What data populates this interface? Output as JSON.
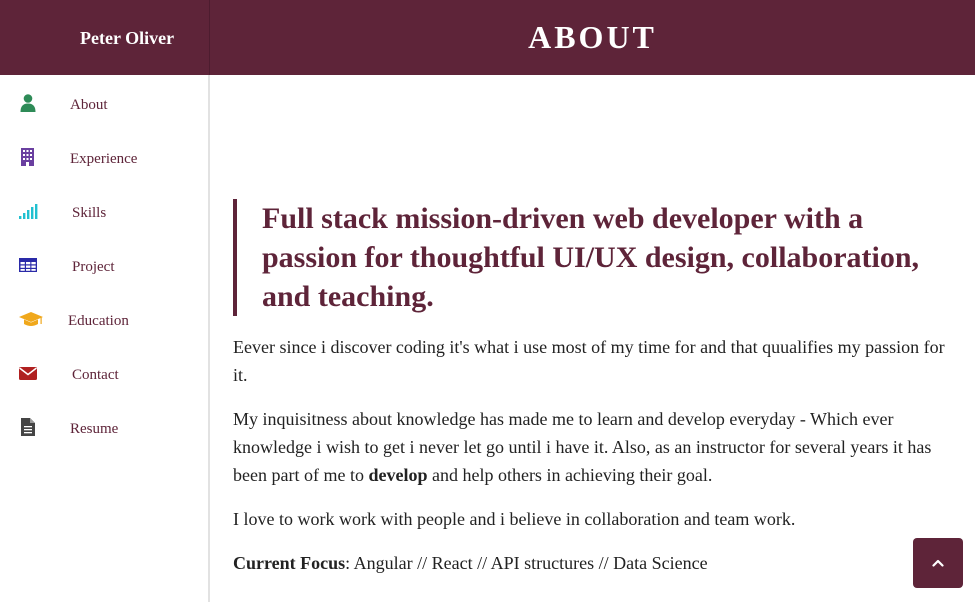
{
  "header": {
    "brand": "Peter Oliver",
    "title": "ABOUT"
  },
  "sidebar": {
    "items": [
      {
        "label": "About",
        "icon": "user-icon",
        "color": "#2e8b57"
      },
      {
        "label": "Experience",
        "icon": "building-icon",
        "color": "#6a3fa0"
      },
      {
        "label": "Skills",
        "icon": "signal-icon",
        "color": "#20c0d0"
      },
      {
        "label": "Project",
        "icon": "table-icon",
        "color": "#2a2aa8"
      },
      {
        "label": "Education",
        "icon": "graduation-cap-icon",
        "color": "#f0a81c"
      },
      {
        "label": "Contact",
        "icon": "envelope-icon",
        "color": "#b02020"
      },
      {
        "label": "Resume",
        "icon": "file-icon",
        "color": "#444444"
      }
    ]
  },
  "main": {
    "headline": "Full stack mission-driven web developer with a passion for thoughtful UI/UX design, collaboration, and teaching.",
    "para1": "Eever since i discover coding it's what i use most of my time for and that quualifies my passion for it.",
    "para2_before": "My inquisitness about knowledge has made me to learn and develop everyday - Which ever knowledge i wish to get i never let go until i have it. Also, as an instructor for several years it has been part of me to ",
    "para2_bold": "develop",
    "para2_after": " and help others in achieving their goal.",
    "para3": "I love to work work with people and i believe in collaboration and team work.",
    "focus_label": "Current Focus",
    "focus_value": ": Angular // React // API structures // Data Science"
  },
  "colors": {
    "brand": "#5e2439",
    "sidebar_border": "#e2e2e2"
  }
}
